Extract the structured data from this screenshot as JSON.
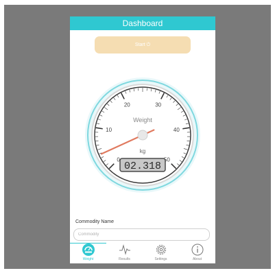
{
  "header": {
    "title": "Dashboard"
  },
  "start_button": {
    "label": "Start ⏻"
  },
  "gauge": {
    "unit_label": "Weight",
    "unit": "kg",
    "reading": "02.318",
    "scale_min": 0,
    "scale_max": 50,
    "tick_labels": [
      "0",
      "10",
      "20",
      "30",
      "40",
      "50"
    ],
    "needle_value": 2.318
  },
  "commodity": {
    "label": "Commodity Name",
    "placeholder": "Commodity",
    "value": ""
  },
  "tabs": [
    {
      "label": "Weight",
      "icon": "scale-icon",
      "active": true
    },
    {
      "label": "Results",
      "icon": "pulse-icon",
      "active": false
    },
    {
      "label": "Settings",
      "icon": "gear-icon",
      "active": false
    },
    {
      "label": "About",
      "icon": "info-icon",
      "active": false
    }
  ],
  "colors": {
    "accent": "#2fc8d1",
    "start_button": "#f5ddb2",
    "needle": "#e07a5f"
  }
}
